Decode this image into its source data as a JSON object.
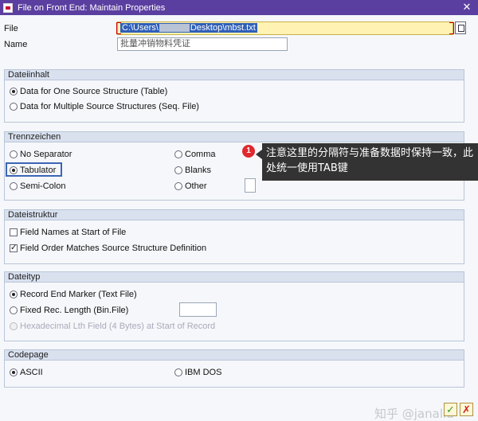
{
  "window": {
    "title": "File on Front End: Maintain Properties"
  },
  "file": {
    "label": "File",
    "value_prefix": "C:\\Users\\",
    "value_suffix": "Desktop\\mbst.txt"
  },
  "name": {
    "label": "Name",
    "value": "批量冲销物料凭证"
  },
  "dateiinhalt": {
    "title": "Dateiinhalt",
    "options": [
      {
        "label": "Data for One Source Structure (Table)",
        "selected": true
      },
      {
        "label": "Data for Multiple Source Structures (Seq. File)",
        "selected": false
      }
    ]
  },
  "trennzeichen": {
    "title": "Trennzeichen",
    "options": [
      {
        "label": "No Separator",
        "selected": false
      },
      {
        "label": "Tabulator",
        "selected": true
      },
      {
        "label": "Semi-Colon",
        "selected": false
      },
      {
        "label": "Comma",
        "selected": false
      },
      {
        "label": "Blanks",
        "selected": false
      },
      {
        "label": "Other",
        "selected": false
      }
    ]
  },
  "dateistruktur": {
    "title": "Dateistruktur",
    "options": [
      {
        "label": "Field Names at Start of File",
        "checked": false
      },
      {
        "label": "Field Order Matches Source Structure Definition",
        "checked": true
      }
    ]
  },
  "dateityp": {
    "title": "Dateityp",
    "options": [
      {
        "label": "Record End Marker (Text File)",
        "selected": true
      },
      {
        "label": "Fixed Rec. Length (Bin.File)",
        "selected": false
      },
      {
        "label": "Hexadecimal Lth Field (4 Bytes) at Start of Record",
        "selected": false,
        "disabled": true
      }
    ]
  },
  "codepage": {
    "title": "Codepage",
    "options": [
      {
        "label": "ASCII",
        "selected": true
      },
      {
        "label": "IBM DOS",
        "selected": false
      }
    ]
  },
  "callout": {
    "badge": "1",
    "text": "注意这里的分隔符与准备数据时保持一致，此处统一使用TAB键"
  },
  "watermark": "知乎 @janaliu",
  "buttons": {
    "ok": "✓",
    "cancel": "✗"
  }
}
